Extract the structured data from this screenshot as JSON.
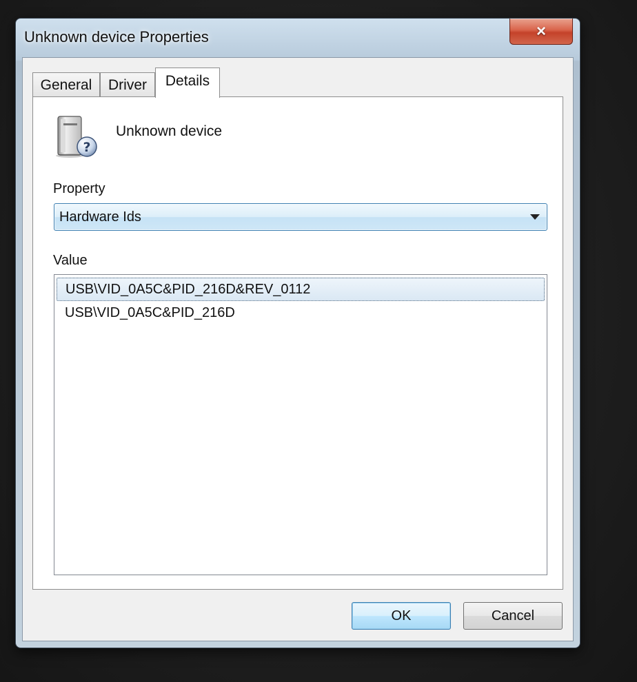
{
  "window": {
    "title": "Unknown device Properties",
    "close_icon": "×"
  },
  "tabs": [
    {
      "label": "General",
      "active": false
    },
    {
      "label": "Driver",
      "active": false
    },
    {
      "label": "Details",
      "active": true
    }
  ],
  "details": {
    "device_name": "Unknown device",
    "device_icon": "unknown-device-icon",
    "property_label": "Property",
    "property_selected": "Hardware Ids",
    "value_label": "Value",
    "values": [
      "USB\\VID_0A5C&PID_216D&REV_0112",
      "USB\\VID_0A5C&PID_216D"
    ]
  },
  "buttons": {
    "ok_label": "OK",
    "cancel_label": "Cancel"
  },
  "colors": {
    "accent": "#3c7fb1",
    "close_button": "#c4422a"
  }
}
